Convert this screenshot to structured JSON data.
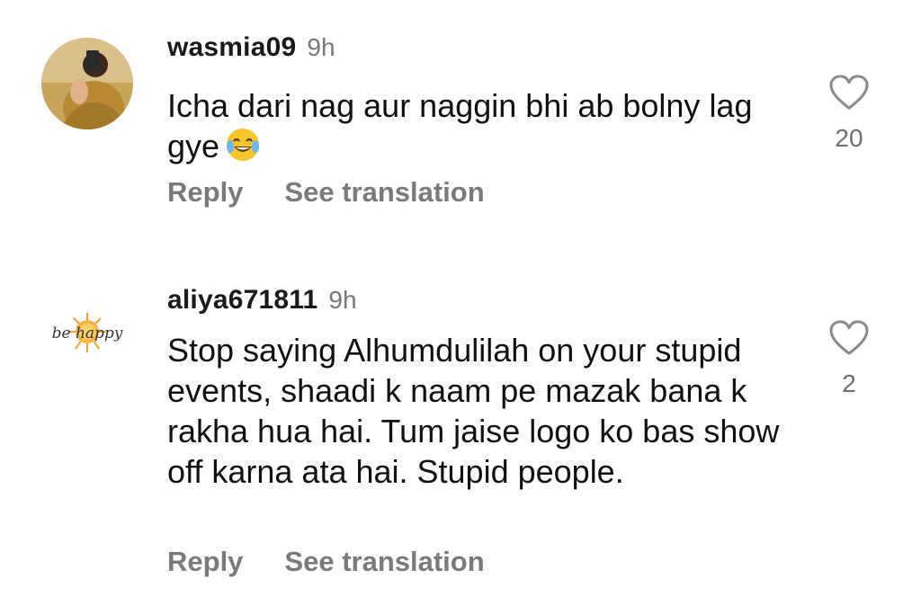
{
  "comments": [
    {
      "username": "wasmia09",
      "timestamp": "9h",
      "text": "Icha dari nag aur naggin bhi ab bolny lag gye",
      "emoji": "face-with-tears-of-joy",
      "likes": "20",
      "reply_label": "Reply",
      "translate_label": "See translation",
      "avatar": "profile-photo"
    },
    {
      "username": "aliya671811",
      "timestamp": "9h",
      "text": "Stop saying Alhumdulilah on your stupid events, shaadi k naam pe mazak bana k rakha hua hai. Tum jaise logo ko bas show off karna ata hai. Stupid people.",
      "likes": "2",
      "reply_label": "Reply",
      "translate_label": "See translation",
      "avatar_text": "be happy"
    }
  ],
  "colors": {
    "text": "#111111",
    "muted": "#777777",
    "action": "#7a7a7a",
    "heart": "#8a8a8a"
  }
}
